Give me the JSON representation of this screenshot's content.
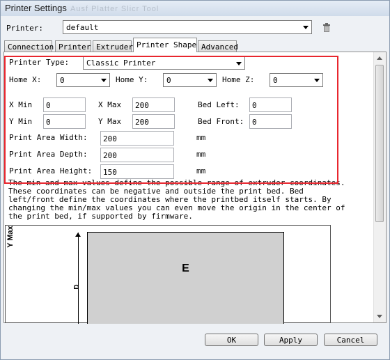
{
  "window": {
    "title": "Printer Settings",
    "ghost_title": "Ausf Platter  Slicr Tool"
  },
  "printer": {
    "label": "Printer:",
    "value": "default",
    "delete_icon": "trash-icon"
  },
  "tabs": [
    {
      "label": "Connection"
    },
    {
      "label": "Printer"
    },
    {
      "label": "Extruder"
    },
    {
      "label": "Printer Shape",
      "active": true
    },
    {
      "label": "Advanced"
    }
  ],
  "shape": {
    "printer_type": {
      "label": "Printer Type:",
      "value": "Classic Printer"
    },
    "home_x": {
      "label": "Home X:",
      "value": "0"
    },
    "home_y": {
      "label": "Home Y:",
      "value": "0"
    },
    "home_z": {
      "label": "Home Z:",
      "value": "0"
    },
    "x_min": {
      "label": "X Min",
      "value": "0"
    },
    "x_max": {
      "label": "X Max",
      "value": "200"
    },
    "bed_left": {
      "label": "Bed Left:",
      "value": "0"
    },
    "y_min": {
      "label": "Y Min",
      "value": "0"
    },
    "y_max": {
      "label": "Y Max",
      "value": "200"
    },
    "bed_front": {
      "label": "Bed Front:",
      "value": "0"
    },
    "area_width": {
      "label": "Print Area Width:",
      "value": "200",
      "unit": "mm"
    },
    "area_depth": {
      "label": "Print Area Depth:",
      "value": "200",
      "unit": "mm"
    },
    "area_height": {
      "label": "Print Area Height:",
      "value": "150",
      "unit": "mm"
    },
    "description": "The min and max values define the possible range of extruder coordinates.\nThese coordinates can be negative and outside the print bed. Bed\nleft/front define the coordinates where the printbed itself starts. By\nchanging the min/max values you can even move the origin in the center of\nthe print bed, if supported by firmware."
  },
  "diagram": {
    "y_axis": "Y Max",
    "d_label": "D",
    "bed_label": "E"
  },
  "buttons": {
    "ok": "OK",
    "apply": "Apply",
    "cancel": "Cancel"
  },
  "colors": {
    "highlight": "#e8262e",
    "bed": "#d0d0d0"
  }
}
